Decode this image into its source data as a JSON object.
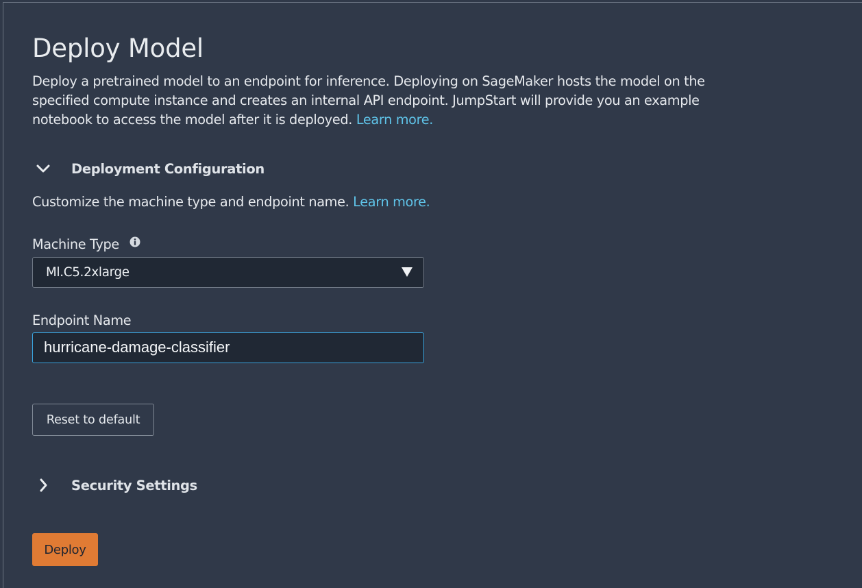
{
  "page": {
    "title": "Deploy Model",
    "description_lines": [
      "Deploy a pretrained model to an endpoint for inference. Deploying on SageMaker hosts the model on the",
      "specified compute instance and creates an internal API endpoint. JumpStart will provide you an example",
      "notebook to access the model after it is deployed."
    ],
    "description_link": "Learn more."
  },
  "deployment_configuration": {
    "title": "Deployment Configuration",
    "expanded": true,
    "icon": "chevron-down-icon",
    "subtext": "Customize the machine type and endpoint name.",
    "subtext_link": "Learn more.",
    "machine_type": {
      "label": "Machine Type",
      "info_icon": "info-icon",
      "value": "Ml.C5.2xlarge",
      "caret_icon": "caret-down-icon"
    },
    "endpoint_name": {
      "label": "Endpoint Name",
      "value": "hurricane-damage-classifier"
    },
    "reset_label": "Reset to default"
  },
  "security_settings": {
    "title": "Security Settings",
    "expanded": false,
    "icon": "chevron-right-icon"
  },
  "actions": {
    "deploy_label": "Deploy"
  },
  "colors": {
    "background": "#303949",
    "link": "#5fc3e8",
    "primary_button": "#e07b34",
    "focus_border": "#3aa4de"
  }
}
